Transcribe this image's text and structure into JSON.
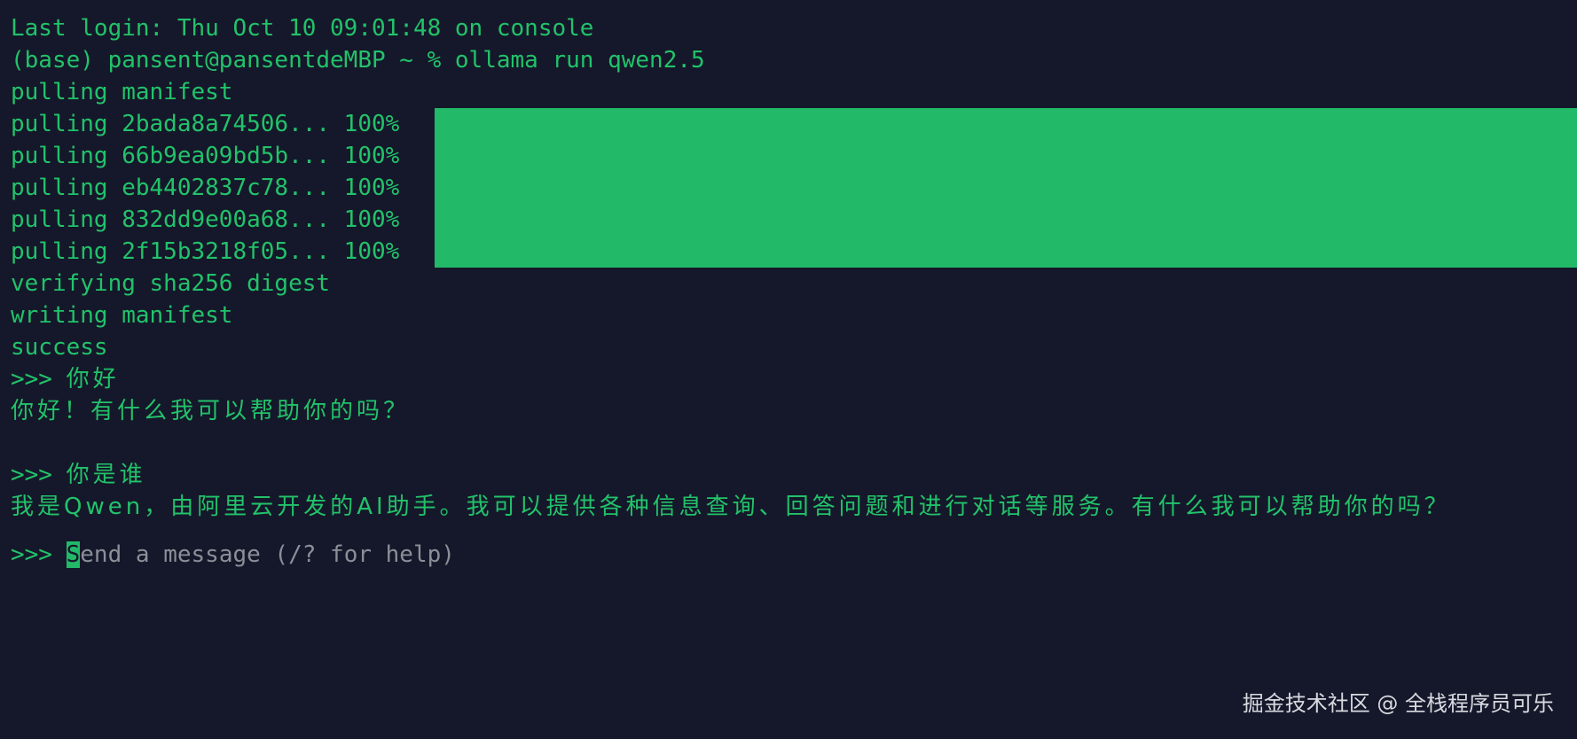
{
  "terminal": {
    "login_line": "Last login: Thu Oct 10 09:01:48 on console",
    "command_line": "(base) pansent@pansentdeMBP ~ % ollama run qwen2.5",
    "pulling_manifest": "pulling manifest",
    "pulls": [
      {
        "label": "pulling 2bada8a74506... 100%",
        "progress": 1.0
      },
      {
        "label": "pulling 66b9ea09bd5b... 100%",
        "progress": 1.0
      },
      {
        "label": "pulling eb4402837c78... 100%",
        "progress": 1.0
      },
      {
        "label": "pulling 832dd9e00a68... 100%",
        "progress": 1.0
      },
      {
        "label": "pulling 2f15b3218f05... 100%",
        "progress": 1.0
      }
    ],
    "verifying": "verifying sha256 digest",
    "writing": "writing manifest",
    "success": "success",
    "conversation": [
      {
        "prompt": ">>> ",
        "user": "你好",
        "reply": "你好！有什么我可以帮助你的吗？"
      },
      {
        "prompt": ">>> ",
        "user": "你是谁",
        "reply": "我是Qwen，由阿里云开发的AI助手。我可以提供各种信息查询、回答问题和进行对话等服务。有什么我可以帮助你的吗？"
      }
    ],
    "input": {
      "prompt": ">>> ",
      "cursor_char": "S",
      "placeholder_rest": "end a message (/? for help)"
    }
  },
  "watermark": "掘金技术社区 @ 全栈程序员可乐",
  "colors": {
    "background": "#15182a",
    "text": "#22c26a",
    "bar": "#22b968",
    "placeholder": "#8b8f98"
  }
}
